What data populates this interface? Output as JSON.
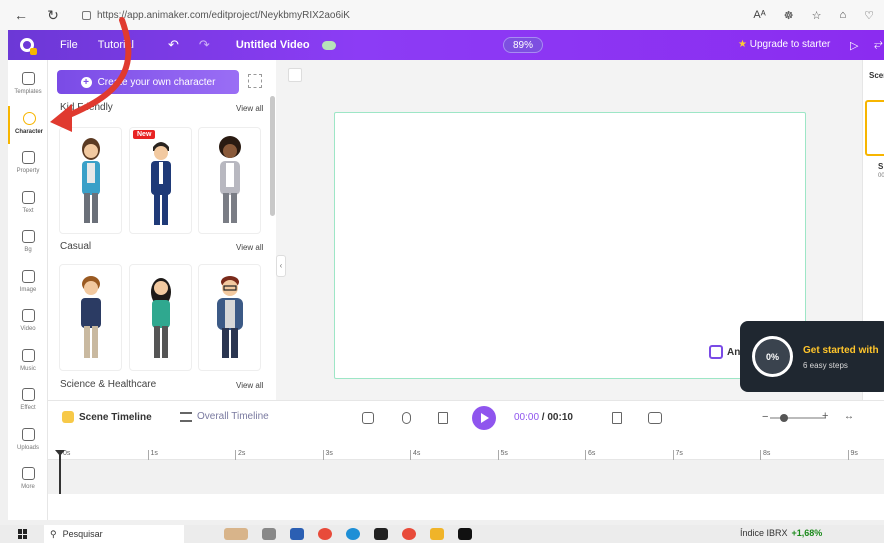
{
  "browser": {
    "url": "https://app.animaker.com/editproject/NeykbmyRIX2ao6iK",
    "right_icons": [
      "Aᴬ",
      "☸",
      "☆",
      "⌂",
      "♡"
    ]
  },
  "appbar": {
    "menu": [
      "File",
      "Tutorial"
    ],
    "undo": "↶",
    "redo": "↷",
    "title": "Untitled Video",
    "zoom": "89%",
    "upgrade_star": "★",
    "upgrade": "Upgrade to starter",
    "play": "▷",
    "share": "⥂"
  },
  "rail": {
    "items": [
      {
        "label": "Templates",
        "icon": "templates-icon"
      },
      {
        "label": "Character",
        "icon": "character-icon"
      },
      {
        "label": "Property",
        "icon": "property-icon"
      },
      {
        "label": "Text",
        "icon": "text-icon"
      },
      {
        "label": "Bg",
        "icon": "bg-icon"
      },
      {
        "label": "Image",
        "icon": "image-icon"
      },
      {
        "label": "Video",
        "icon": "video-icon"
      },
      {
        "label": "Music",
        "icon": "music-icon"
      },
      {
        "label": "Effect",
        "icon": "effect-icon"
      },
      {
        "label": "Uploads",
        "icon": "uploads-icon"
      },
      {
        "label": "More",
        "icon": "more-icon"
      }
    ]
  },
  "panel": {
    "create_btn": "Create your own character",
    "sections": [
      {
        "title": "Kid Friendly",
        "view_all": "View all"
      },
      {
        "title": "Casual",
        "view_all": "View all"
      },
      {
        "title": "Science & Healthcare",
        "view_all": "View all"
      }
    ],
    "new_badge": "New"
  },
  "watermark": {
    "text": "An"
  },
  "right_panel": {
    "header": "Scenes",
    "scene_label": "S",
    "scene_time": "00"
  },
  "onboarding": {
    "percent": "0%",
    "title": "Get started with",
    "subtitle": "6 easy steps"
  },
  "timeline": {
    "scene_tab": "Scene Timeline",
    "overall_tab": "Overall Timeline",
    "current_time": "00:00",
    "separator": " / ",
    "total_time": "00:10",
    "zoom_minus": "−",
    "zoom_plus": "+",
    "zoom_level": 0.2,
    "fit_icon": "↔",
    "ruler": [
      "0s",
      "1s",
      "2s",
      "3s",
      "4s",
      "5s",
      "6s",
      "7s",
      "8s",
      "9s"
    ]
  },
  "taskbar": {
    "search": "Pesquisar",
    "ticker_name": "Índice IBRX",
    "ticker_change": "+1,68%"
  },
  "colors": {
    "brand": "#8b3cf5",
    "accent": "#f7b500",
    "canvas_border": "#9de6c6",
    "play": "#8f55ee",
    "onboard_bg": "#1f2730",
    "onboard_title": "#ffc52b",
    "arrow": "#e03a2f"
  }
}
